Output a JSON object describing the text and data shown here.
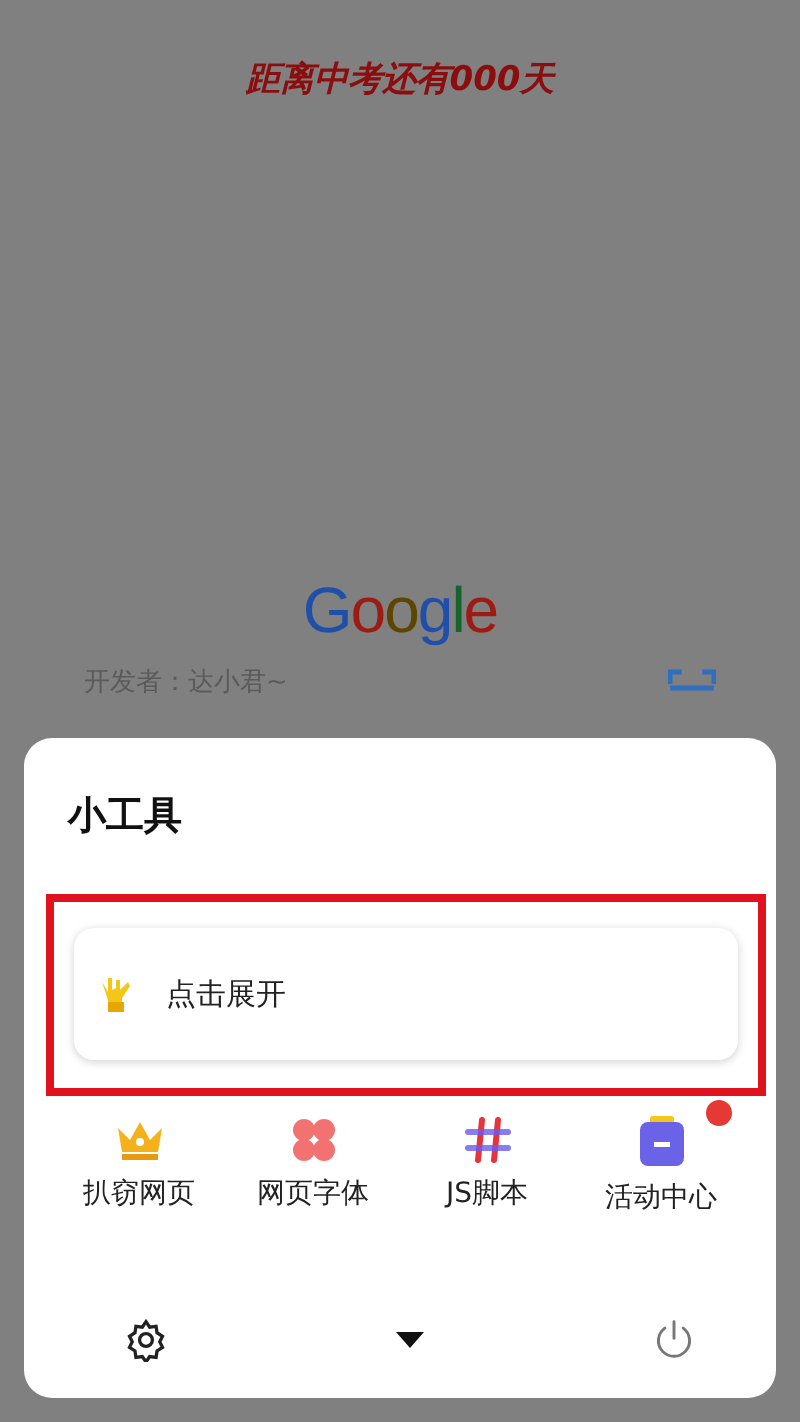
{
  "countdown": "距离中考还有000天",
  "logo": "Google",
  "developer": "开发者：达小君~",
  "sheet": {
    "title": "小工具",
    "expand_card": {
      "label": "点击展开",
      "highlighted": true
    },
    "tools": [
      {
        "label": "扒窃网页",
        "kind": "crown",
        "badge": false
      },
      {
        "label": "网页字体",
        "kind": "flower",
        "badge": false
      },
      {
        "label": "JS脚本",
        "kind": "hash",
        "badge": false
      },
      {
        "label": "活动中心",
        "kind": "box",
        "badge": true
      }
    ]
  }
}
